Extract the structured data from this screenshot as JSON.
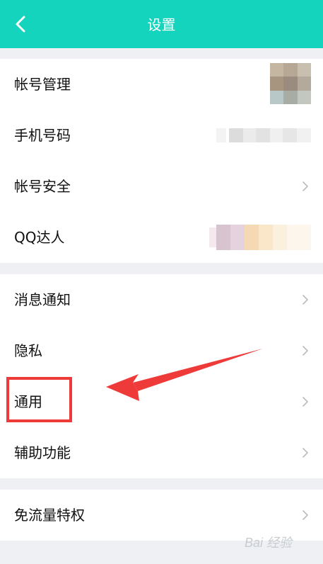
{
  "header": {
    "title": "设置",
    "back_icon": "chevron-left-icon"
  },
  "group1": {
    "items": [
      {
        "label": "帐号管理"
      },
      {
        "label": "手机号码"
      },
      {
        "label": "帐号安全"
      },
      {
        "label": "QQ达人"
      }
    ]
  },
  "group2": {
    "items": [
      {
        "label": "消息通知"
      },
      {
        "label": "隐私"
      },
      {
        "label": "通用"
      },
      {
        "label": "辅助功能"
      }
    ]
  },
  "group3": {
    "items": [
      {
        "label": "免流量特权"
      }
    ]
  },
  "colors": {
    "accent": "#14d4bd",
    "annotation": "#ef3a3a"
  },
  "watermark": {
    "text": "Bai 经验"
  }
}
